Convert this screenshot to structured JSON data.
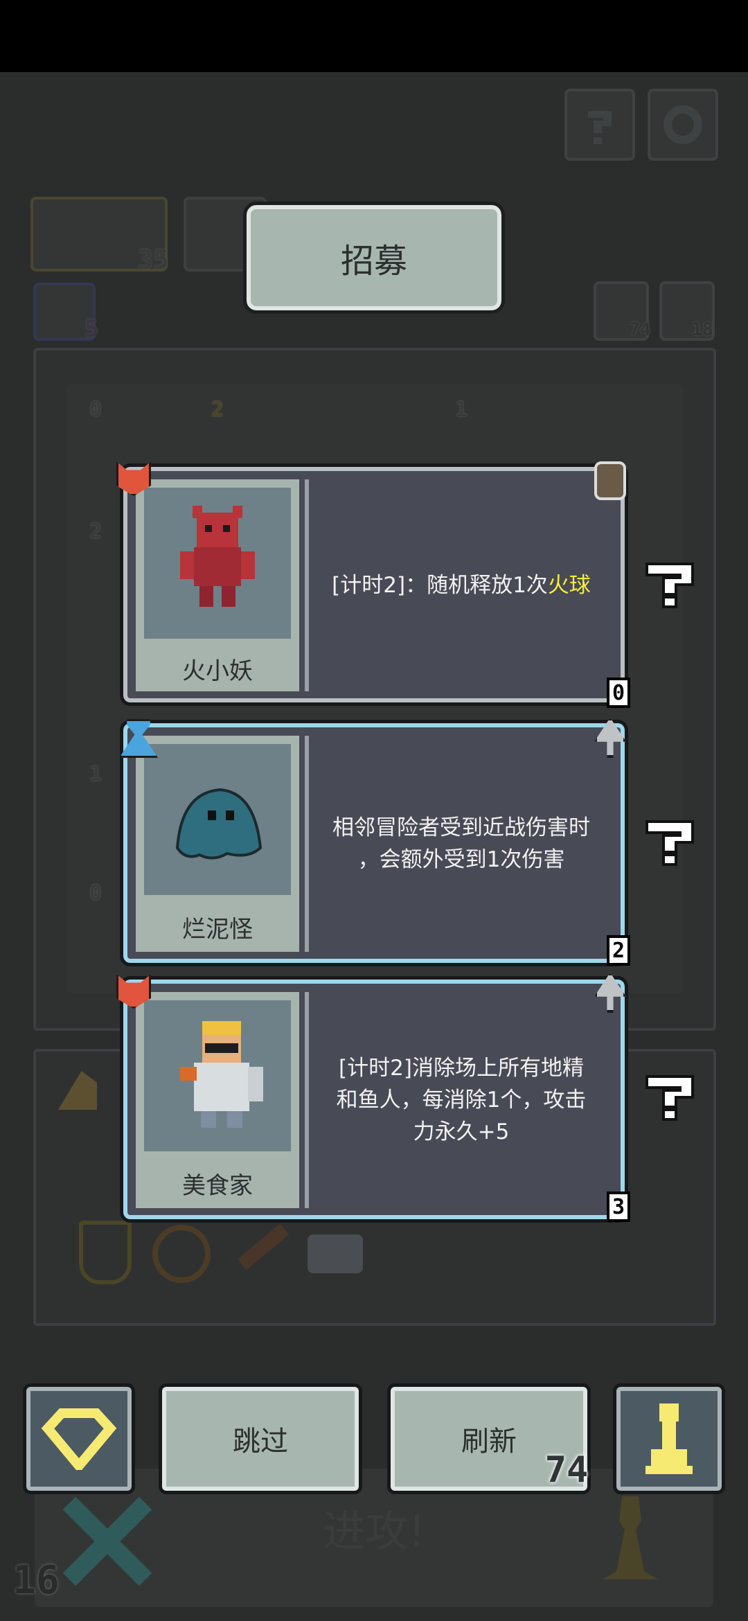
{
  "header": {
    "title": "招募"
  },
  "background": {
    "counter_35": "35",
    "counter_5": "5",
    "counter_74_small": "74",
    "counter_18": "18",
    "board_digits": [
      "0",
      "2",
      "1",
      "2",
      "1",
      "0"
    ],
    "attack_label": "进攻!",
    "level": "16"
  },
  "cards": [
    {
      "name": "火小妖",
      "desc_before": "[计时2]：随机释放1次",
      "desc_highlight": "火球",
      "desc_after": "",
      "corner": "0",
      "badge_icon": "fox-head-icon",
      "type_icon": "shield-icon"
    },
    {
      "name": "烂泥怪",
      "desc_line1": "相邻冒险者受到近战伤害时",
      "desc_line2": "，会额外受到1次伤害",
      "corner": "2",
      "badge_icon": "potion-icon",
      "type_icon": "sword-icon"
    },
    {
      "name": "美食家",
      "desc_line1": "[计时2]消除场上所有地精",
      "desc_line2": "和鱼人，每消除1个，攻击",
      "desc_line3": "力永久+5",
      "corner": "3",
      "badge_icon": "fox-head-icon",
      "type_icon": "sword-icon"
    }
  ],
  "actions": {
    "skip": "跳过",
    "refresh": "刷新",
    "refresh_cost": "74"
  },
  "colors": {
    "accent_yellow": "#f5ee34",
    "card_border_blue": "#9ed7ec",
    "card_bg": "#484a56"
  }
}
